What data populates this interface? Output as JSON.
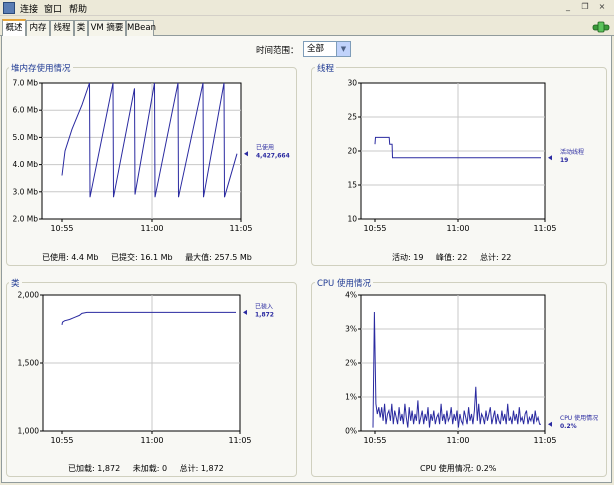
{
  "menu": {
    "items": [
      "连接",
      "窗口",
      "帮助"
    ]
  },
  "window_buttons": [
    "_",
    "❐",
    "×"
  ],
  "tabs": [
    {
      "label": "概述",
      "active": true
    },
    {
      "label": "内存",
      "active": false
    },
    {
      "label": "线程",
      "active": false
    },
    {
      "label": "类",
      "active": false
    },
    {
      "label": "VM 摘要",
      "active": false
    },
    {
      "label": "MBean",
      "active": false
    }
  ],
  "time_range": {
    "label": "时间范围：",
    "value": "全部"
  },
  "panels": {
    "heap": {
      "title": "堆内存使用情况",
      "y_ticks": [
        "7.0 Mb",
        "6.0 Mb",
        "5.0 Mb",
        "4.0 Mb",
        "3.0 Mb",
        "2.0 Mb"
      ],
      "x_ticks": [
        "10:55",
        "11:00",
        "11:05"
      ],
      "legend": {
        "name": "已使用",
        "value": "4,427,664"
      },
      "stats": [
        {
          "label": "已使用:",
          "value": "4.4 Mb"
        },
        {
          "label": "已提交:",
          "value": "16.1 Mb"
        },
        {
          "label": "最大值:",
          "value": "257.5 Mb"
        }
      ]
    },
    "threads": {
      "title": "线程",
      "y_ticks": [
        "30",
        "25",
        "20",
        "15",
        "10"
      ],
      "x_ticks": [
        "10:55",
        "11:00",
        "11:05"
      ],
      "legend": {
        "name": "活动线程",
        "value": "19"
      },
      "stats": [
        {
          "label": "活动:",
          "value": "19"
        },
        {
          "label": "峰值:",
          "value": "22"
        },
        {
          "label": "总计:",
          "value": "22"
        }
      ]
    },
    "classes": {
      "title": "类",
      "y_ticks": [
        "2,000",
        "1,500",
        "1,000"
      ],
      "x_ticks": [
        "10:55",
        "11:00",
        "11:05"
      ],
      "legend": {
        "name": "已装入",
        "value": "1,872"
      },
      "stats": [
        {
          "label": "已加载:",
          "value": "1,872"
        },
        {
          "label": "未加载:",
          "value": "0"
        },
        {
          "label": "总计:",
          "value": "1,872"
        }
      ]
    },
    "cpu": {
      "title": "CPU 使用情况",
      "y_ticks": [
        "4%",
        "3%",
        "2%",
        "1%",
        "0%"
      ],
      "x_ticks": [
        "10:55",
        "11:00",
        "11:05"
      ],
      "legend": {
        "name": "CPU 使用情况",
        "value": "0.2%"
      },
      "stats": [
        {
          "label": "CPU 使用情况:",
          "value": "0.2%"
        }
      ]
    }
  },
  "chart_data": [
    {
      "type": "line",
      "title": "堆内存使用情况",
      "ylabel": "Mb",
      "ylim": [
        2.0,
        7.0
      ],
      "x_ticks": [
        "10:55",
        "11:00",
        "11:05"
      ],
      "series": [
        {
          "name": "已使用",
          "points": [
            [
              0,
              3.6
            ],
            [
              0.6,
              4.5
            ],
            [
              2,
              5.3
            ],
            [
              4,
              6.2
            ],
            [
              5.5,
              7.0
            ],
            [
              5.6,
              2.8
            ],
            [
              10.2,
              7.0
            ],
            [
              10.3,
              2.8
            ],
            [
              14.5,
              6.8
            ],
            [
              14.6,
              2.9
            ],
            [
              18.5,
              7.0
            ],
            [
              18.6,
              2.8
            ],
            [
              23.2,
              7.0
            ],
            [
              23.3,
              2.8
            ],
            [
              28.2,
              7.0
            ],
            [
              28.3,
              2.8
            ],
            [
              32.4,
              7.0
            ],
            [
              32.5,
              2.8
            ],
            [
              35,
              4.4
            ]
          ]
        }
      ]
    },
    {
      "type": "line",
      "title": "线程",
      "ylim": [
        10,
        30
      ],
      "x_ticks": [
        "10:55",
        "11:00",
        "11:05"
      ],
      "series": [
        {
          "name": "活动线程",
          "points": [
            [
              0,
              21
            ],
            [
              0.1,
              22
            ],
            [
              3,
              22
            ],
            [
              3.1,
              21
            ],
            [
              3.6,
              21
            ],
            [
              3.7,
              19
            ],
            [
              35,
              19
            ]
          ]
        }
      ]
    },
    {
      "type": "line",
      "title": "类",
      "ylim": [
        1000,
        2000
      ],
      "x_ticks": [
        "10:55",
        "11:00",
        "11:05"
      ],
      "series": [
        {
          "name": "已装入",
          "points": [
            [
              0,
              1780
            ],
            [
              0.1,
              1800
            ],
            [
              0.5,
              1810
            ],
            [
              1.5,
              1820
            ],
            [
              2.5,
              1835
            ],
            [
              3.5,
              1850
            ],
            [
              4,
              1865
            ],
            [
              5,
              1872
            ],
            [
              35,
              1872
            ]
          ]
        }
      ]
    },
    {
      "type": "line",
      "title": "CPU 使用情况",
      "ylim": [
        0,
        4
      ],
      "x_ticks": [
        "10:55",
        "11:00",
        "11:05"
      ],
      "series": [
        {
          "name": "CPU 使用情况",
          "values": [
            0.1,
            3.5,
            0.8,
            0.5,
            0.7,
            0.4,
            0.7,
            0.3,
            0.8,
            0.2,
            0.5,
            0.6,
            0.3,
            0.8,
            0.2,
            0.6,
            0.4,
            0.2,
            0.7,
            0.3,
            0.5,
            0.2,
            0.8,
            0.4,
            0.1,
            0.7,
            0.3,
            0.6,
            0.2,
            0.5,
            0.3,
            0.9,
            0.2,
            0.4,
            0.6,
            0.2,
            0.5,
            0.3,
            0.7,
            0.1,
            0.5,
            0.3,
            0.6,
            0.2,
            0.4,
            0.5,
            0.2,
            0.8,
            0.3,
            0.5,
            0.2,
            0.6,
            0.3,
            0.4,
            0.7,
            0.2,
            0.5,
            0.3,
            0.6,
            0.1,
            0.5,
            0.3,
            0.2,
            0.6,
            0.4,
            0.2,
            0.7,
            0.3,
            0.5,
            0.2,
            0.6,
            1.3,
            0.3,
            0.8,
            0.2,
            0.5,
            0.4,
            0.2,
            0.6,
            0.3,
            0.5,
            0.7,
            0.2,
            0.4,
            0.6,
            0.2,
            0.5,
            0.3,
            0.2,
            0.6,
            0.3,
            0.5,
            0.2,
            0.8,
            0.3,
            0.4,
            0.2,
            0.6,
            0.3,
            0.5,
            0.2,
            0.7,
            0.3,
            0.4,
            0.2,
            0.5,
            0.6,
            0.2,
            0.4,
            0.3,
            0.5,
            0.2,
            0.6,
            0.3,
            0.4,
            0.2,
            0.2
          ]
        }
      ]
    }
  ],
  "colors": {
    "line": "#2a2aa0",
    "grid": "#c8c8c8",
    "title": "#1f3a93",
    "plot_bg": "#ffffff",
    "axis": "#000000"
  },
  "icons": [
    "app-icon",
    "network-status-icon"
  ]
}
